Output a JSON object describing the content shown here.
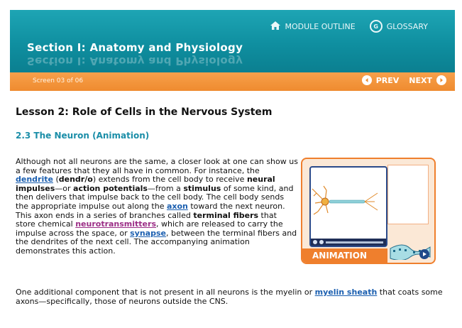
{
  "header": {
    "module_outline_label": "MODULE OUTLINE",
    "glossary_label": "GLOSSARY",
    "section_title": "Section I: Anatomy and Physiology"
  },
  "bar": {
    "screen_indicator": "Screen 03 of 06",
    "prev_label": "PREV",
    "next_label": "NEXT"
  },
  "content": {
    "lesson_title": "Lesson 2: Role of Cells in the Nervous System",
    "subsection_title": "2.3 The Neuron (Animation)",
    "p1": {
      "t1": "Although not all neurons are the same, a closer look at one can show us a few features that they all have in common. For instance, the ",
      "dendrite": "dendrite",
      "t2": " (",
      "dendr": "dendr/o",
      "t3": ") extends from the cell body to receive ",
      "neural_impulses": "neural impulses",
      "t4": "—or ",
      "action_potentials": "action potentials",
      "t5": "—from a ",
      "stimulus": "stimulus",
      "t6": " of some kind, and then delivers that impulse back to the cell body. The cell body sends the appropriate impulse out along the ",
      "axon": "axon",
      "t7": " toward the next neuron. This axon ends in a series of branches called ",
      "terminal_fibers": "terminal fibers",
      "t8": " that store chemical ",
      "neurotransmitters": "neurotransmitters",
      "t9": ", which are released to carry the impulse across the space, or ",
      "synapse": "synapse",
      "t10": ", between the terminal fibers and the dendrites of the next cell. The accompanying animation demonstrates this action."
    },
    "p2": {
      "t1": "One additional component that is not present in all neurons is the myelin or ",
      "myelin_sheath": "myelin sheath",
      "t2": " that coats some axons—specifically, those of neurons outside the CNS."
    }
  },
  "animation": {
    "label": "ANIMATION"
  },
  "colors": {
    "teal": "#0f8fa0",
    "orange": "#ef8b2f",
    "link_blue": "#1b5fb0",
    "link_purple": "#9b2d86",
    "subheading": "#1b8ea8"
  }
}
